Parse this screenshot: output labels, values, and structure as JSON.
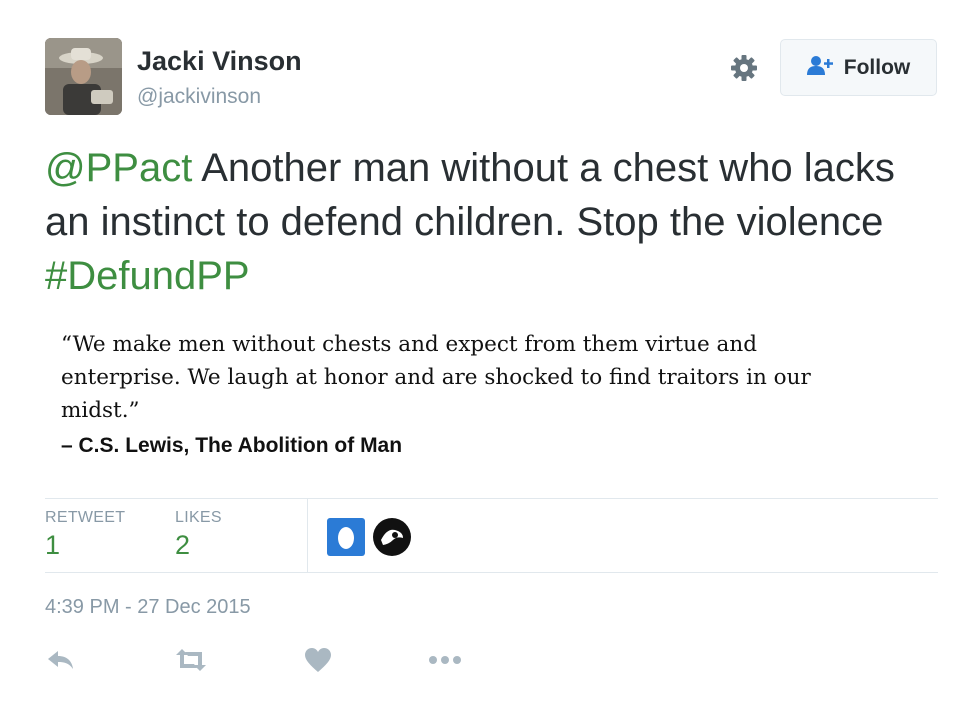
{
  "user": {
    "display_name": "Jacki Vinson",
    "screen_name": "@jackivinson"
  },
  "header": {
    "settings_icon": "gear-icon",
    "follow_label": "Follow",
    "follow_icon": "add-user-icon"
  },
  "tweet": {
    "mention": "@PPact",
    "text": " Another man without a chest who lacks an instinct to defend children.  Stop the violence  ",
    "hashtag": "#DefundPP"
  },
  "quote_image": {
    "quote": "“We make men without chests and expect from them virtue and enterprise. We laugh at honor and are shocked to find traitors in our midst.”",
    "attribution": "– C.S. Lewis, The Abolition of Man"
  },
  "stats": {
    "retweets_label": "RETWEET",
    "retweets_count": "1",
    "likes_label": "LIKES",
    "likes_count": "2"
  },
  "timestamp": "4:39 PM - 27 Dec 2015",
  "actions": [
    "reply-icon",
    "retweet-icon",
    "like-icon",
    "more-icon"
  ],
  "colors": {
    "link": "#3e8e41",
    "muted": "#8899a6",
    "text": "#292f33",
    "liker_blue": "#2b7bd6"
  }
}
